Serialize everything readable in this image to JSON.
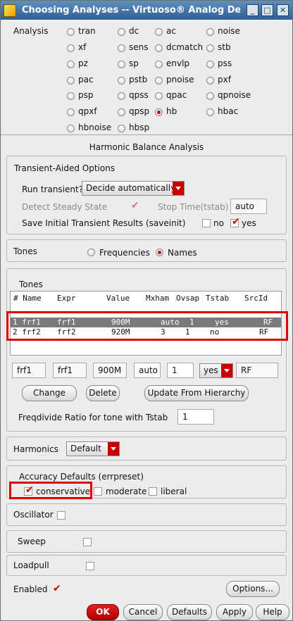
{
  "window": {
    "title": "Choosing Analyses -- Virtuoso® Analog Des",
    "minimize": "_",
    "maximize": "□",
    "close": "✕"
  },
  "analysis": {
    "label": "Analysis",
    "options": [
      "tran",
      "dc",
      "ac",
      "noise",
      "xf",
      "sens",
      "dcmatch",
      "stb",
      "pz",
      "sp",
      "envlp",
      "pss",
      "pac",
      "pstb",
      "pnoise",
      "pxf",
      "psp",
      "qpss",
      "qpac",
      "qpnoise",
      "qpxf",
      "qpsp",
      "hb",
      "hbac",
      "hbnoise",
      "hbsp"
    ],
    "selected": "hb"
  },
  "section_title": "Harmonic Balance Analysis",
  "transient": {
    "group_label": "Transient-Aided Options",
    "run_label": "Run transient?",
    "run_value": "Decide automatically",
    "detect_label": "Detect Steady State",
    "stop_label": "Stop Time(tstab)",
    "stop_value": "auto",
    "save_label": "Save Initial Transient Results (saveinit)",
    "no_label": "no",
    "yes_label": "yes"
  },
  "tones_mode": {
    "label": "Tones",
    "frequencies": "Frequencies",
    "names": "Names",
    "selected": "Names"
  },
  "tones": {
    "group_label": "Tones",
    "columns": [
      "# Name",
      "Expr",
      "Value",
      "Mxham",
      "Ovsap",
      "Tstab",
      "SrcId"
    ],
    "rows": [
      [
        "1 frf1",
        "frf1",
        "900M",
        "auto",
        "1",
        "yes",
        "RF"
      ],
      [
        "2 frf2",
        "frf2",
        "920M",
        "3",
        "1",
        "no",
        "RF"
      ]
    ],
    "edit": {
      "name": "frf1",
      "expr": "frf1",
      "value": "900M",
      "mxham": "auto",
      "ovsap": "1",
      "tstab": "yes",
      "srcid": "RF"
    },
    "change_btn": "Change",
    "delete_btn": "Delete",
    "update_btn": "Update From Hierarchy",
    "freqdivide_label": "Freqdivide Ratio for tone with Tstab",
    "freqdivide_value": "1"
  },
  "harmonics": {
    "label": "Harmonics",
    "value": "Default"
  },
  "accuracy": {
    "label": "Accuracy Defaults (errpreset)",
    "options": [
      "conservative",
      "moderate",
      "liberal"
    ],
    "selected": "conservative"
  },
  "oscillator_label": "Oscillator",
  "sweep_label": "Sweep",
  "loadpull_label": "Loadpull",
  "enabled_label": "Enabled",
  "options_btn": "Options...",
  "footer": {
    "ok": "OK",
    "cancel": "Cancel",
    "defaults": "Defaults",
    "apply": "Apply",
    "help": "Help"
  },
  "colors": {
    "accent": "#c40000",
    "highlight": "#e00000",
    "title_bar": "#3a6a9e"
  }
}
